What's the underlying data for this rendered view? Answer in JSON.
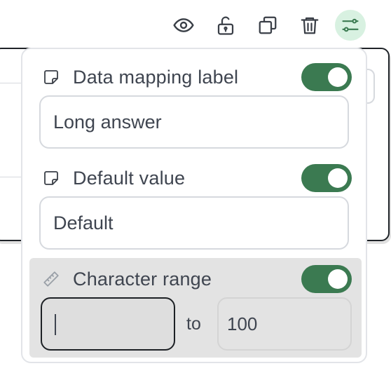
{
  "toolbar": {
    "icons": [
      "eye-icon",
      "unlock-icon",
      "duplicate-icon",
      "trash-icon",
      "sliders-icon"
    ],
    "active_icon": "sliders-icon",
    "active_bg": "#d8f1e1"
  },
  "settings": {
    "data_mapping": {
      "label": "Data mapping label",
      "icon": "sticky-note-icon",
      "enabled": true,
      "value": "Long answer"
    },
    "default_value": {
      "label": "Default value",
      "icon": "sticky-note-icon",
      "enabled": true,
      "value": "Default"
    },
    "character_range": {
      "label": "Character range",
      "icon": "ruler-icon",
      "enabled": true,
      "min_value": "",
      "separator": "to",
      "max_placeholder": "100"
    }
  },
  "colors": {
    "toggle_on": "#3b7a51",
    "text": "#3f4550",
    "range_panel": "#e3e3e3"
  }
}
